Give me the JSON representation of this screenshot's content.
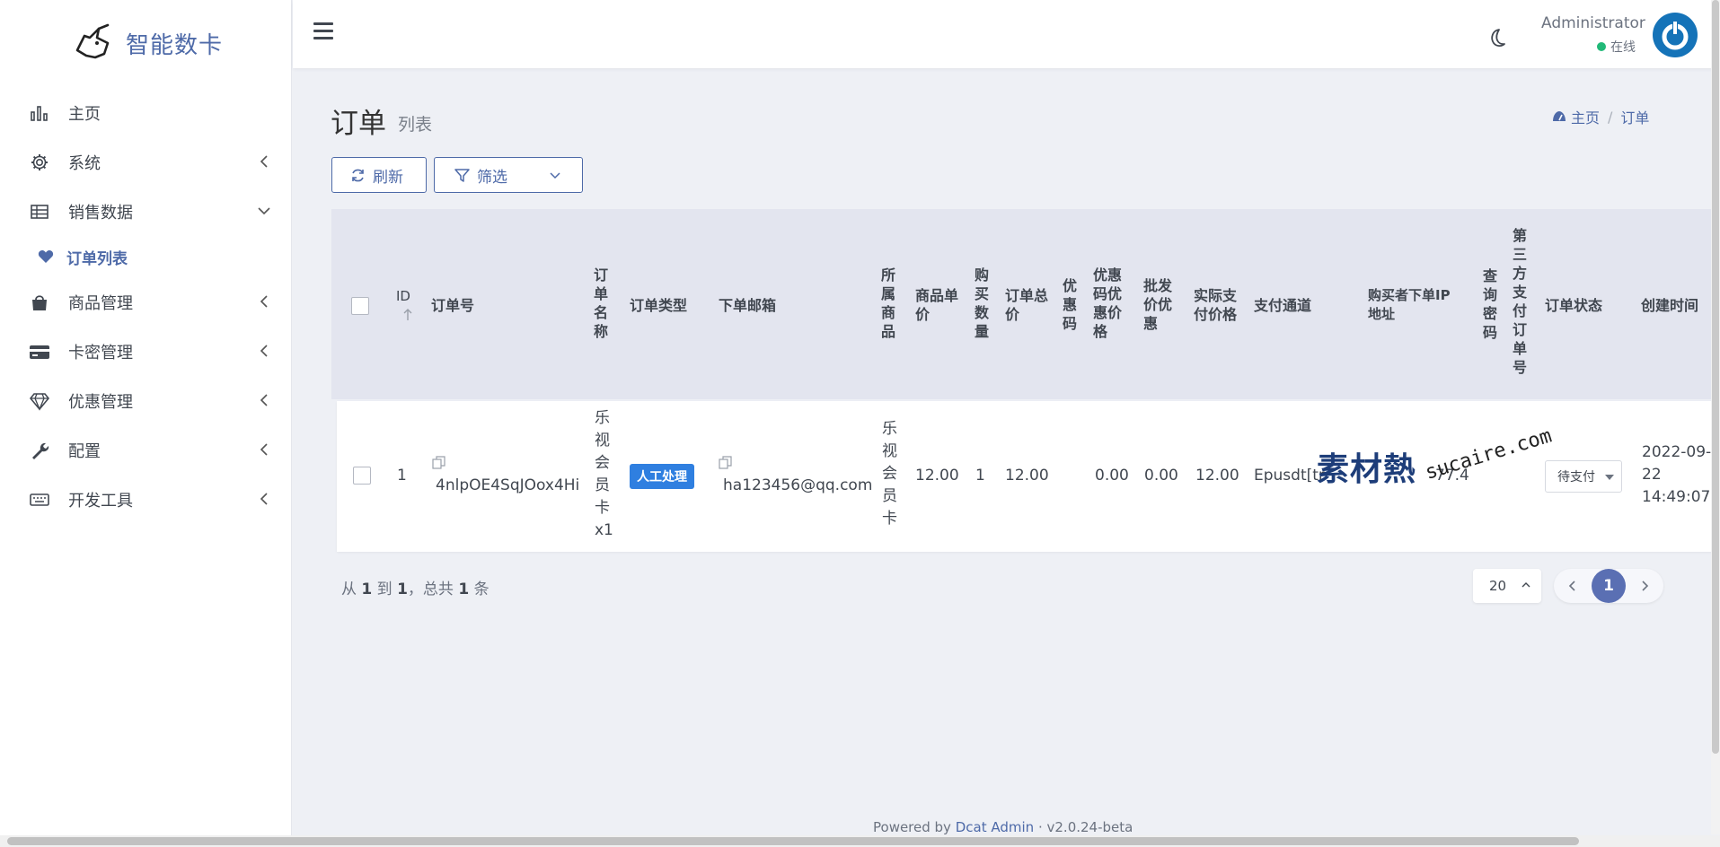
{
  "brand": {
    "name": "智能数卡"
  },
  "sidebar": {
    "items": [
      {
        "label": "主页",
        "icon": "bar-chart-icon"
      },
      {
        "label": "系统",
        "icon": "gear-icon"
      },
      {
        "label": "销售数据",
        "icon": "table-icon"
      },
      {
        "label": "订单列表",
        "icon": "heart-icon"
      },
      {
        "label": "商品管理",
        "icon": "shopping-bag-icon"
      },
      {
        "label": "卡密管理",
        "icon": "credit-card-icon"
      },
      {
        "label": "优惠管理",
        "icon": "diamond-icon"
      },
      {
        "label": "配置",
        "icon": "wrench-icon"
      },
      {
        "label": "开发工具",
        "icon": "keyboard-icon"
      }
    ]
  },
  "header": {
    "user_name": "Administrator",
    "user_status": "在线",
    "status_color": "#21b978"
  },
  "page": {
    "title": "订单",
    "subtitle": "列表",
    "breadcrumb": {
      "home": "主页",
      "current": "订单"
    }
  },
  "toolbar": {
    "refresh_label": "刷新",
    "filter_label": "筛选"
  },
  "table": {
    "headers": {
      "id": "ID",
      "order_sn": "订单号",
      "title": "订单名称",
      "type": "订单类型",
      "email": "下单邮箱",
      "goods": "所属商品",
      "goods_price": "商品单价",
      "buy_amount": "购买数量",
      "total_price": "订单总价",
      "coupon": "优惠码",
      "coupon_discount": "优惠码优惠价格",
      "wholesale_discount": "批发价优惠",
      "actual_price": "实际支付价格",
      "pay": "支付通道",
      "ip": "购买者下单IP地址",
      "search_pwd": "查询密码",
      "trade_no": "第三方支付订单号",
      "status": "订单状态",
      "created_at": "创建时间"
    },
    "rows": [
      {
        "id": "1",
        "order_sn": "4nlpOE4SqJOox4Hi",
        "title": "乐视会员卡x1",
        "type": "人工处理",
        "email": "ha123456@qq.com",
        "goods": "乐视会员卡",
        "goods_price": "12.00",
        "buy_amount": "1",
        "total_price": "12.00",
        "coupon": "",
        "coupon_discount": "0.00",
        "wholesale_discount": "0.00",
        "actual_price": "12.00",
        "pay": "Epusdt[tr",
        "ip": "77.4",
        "status": "待支付",
        "created_at": "2022-09-22 14:49:07"
      }
    ]
  },
  "pagination": {
    "summary_prefix": "从",
    "from": "1",
    "summary_mid": "到",
    "to": "1",
    "summary_total_prefix": "，总共",
    "total": "1",
    "summary_suffix": "条",
    "per_page": "20",
    "current_page": "1"
  },
  "footer": {
    "powered_prefix": "Powered by",
    "powered_link": "Dcat Admin",
    "version": "·  v2.0.24-beta"
  },
  "watermark": {
    "zh": "素材熱",
    "en": "sucaire.com"
  },
  "colors": {
    "accent": "#4e6aa8",
    "badge": "#2f7fe0",
    "page_current": "#5a6fb3"
  }
}
